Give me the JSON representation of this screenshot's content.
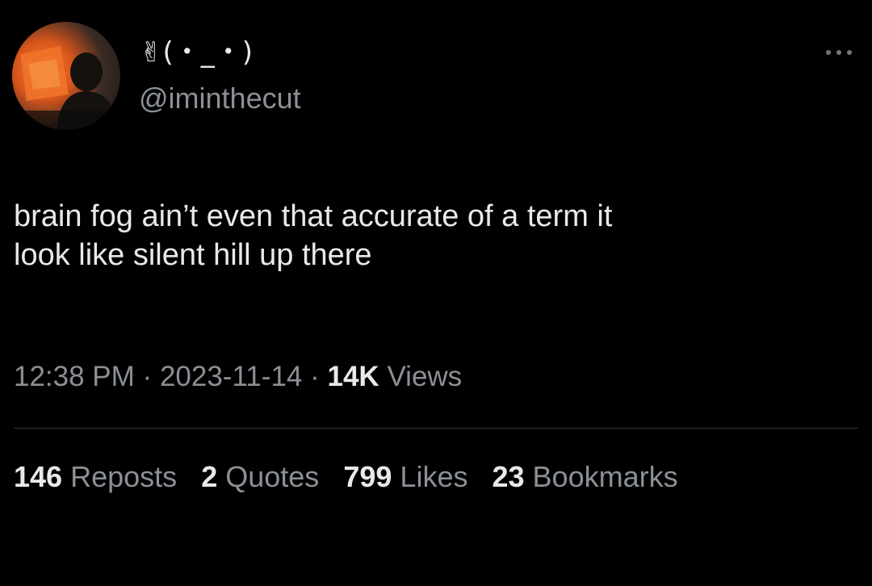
{
  "author": {
    "display_name": "✌(・_・)",
    "handle": "@iminthecut",
    "avatar_icon": "user-avatar"
  },
  "tweet": {
    "text_line1": "brain fog ain’t even that accurate of a term it",
    "text_line2": "look like silent hill up there"
  },
  "meta": {
    "time": "12:38 PM",
    "separator": "·",
    "date": "2023-11-14",
    "views_count": "14K",
    "views_label": "Views"
  },
  "stats": {
    "reposts_count": "146",
    "reposts_label": "Reposts",
    "quotes_count": "2",
    "quotes_label": "Quotes",
    "likes_count": "799",
    "likes_label": "Likes",
    "bookmarks_count": "23",
    "bookmarks_label": "Bookmarks"
  },
  "colors": {
    "background": "#000000",
    "primary_text": "#e7e9ea",
    "secondary_text": "#8b9096",
    "divider": "#2f3336"
  },
  "icons": {
    "more": "more-options-icon"
  }
}
